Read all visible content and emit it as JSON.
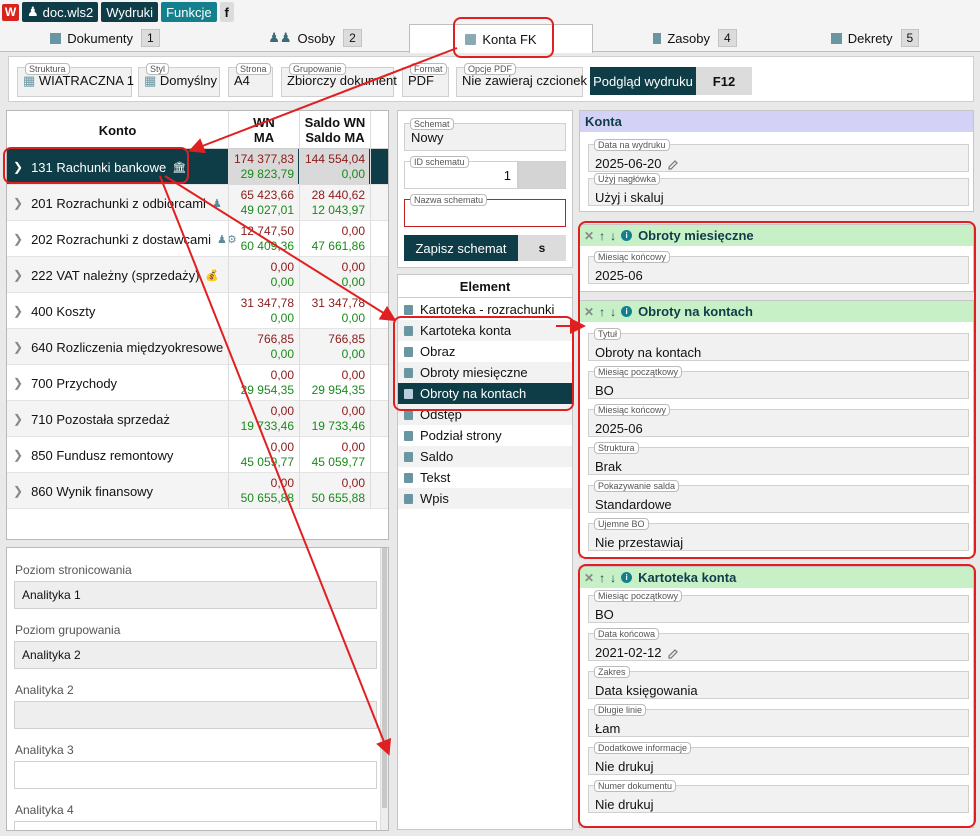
{
  "topbar": {
    "user": "doc.wls2",
    "menu1": "Wydruki",
    "menu2": "Funkcje",
    "menu3": "f"
  },
  "tabs": [
    {
      "label": "Dokumenty",
      "num": "1"
    },
    {
      "label": "Osoby",
      "num": "2"
    },
    {
      "label": "Konta FK",
      "num": ""
    },
    {
      "label": "Zasoby",
      "num": "4"
    },
    {
      "label": "Dekrety",
      "num": "5"
    }
  ],
  "options": {
    "struktura": {
      "label": "Struktura",
      "value": "WIATRACZNA 1"
    },
    "styl": {
      "label": "Styl",
      "value": "Domyślny"
    },
    "strona": {
      "label": "Strona",
      "value": "A4"
    },
    "grupowanie": {
      "label": "Grupowanie",
      "value": "Zbiorczy dokument"
    },
    "format": {
      "label": "Format",
      "value": "PDF"
    },
    "opcje": {
      "label": "Opcje PDF",
      "value": "Nie zawieraj czcionek"
    },
    "preview": "Podgląd wydruku",
    "preview_key": "F12"
  },
  "accounts": {
    "col_konto": "Konto",
    "col_wn1": "WN",
    "col_wn2": "MA",
    "col_saldo1": "Saldo WN",
    "col_saldo2": "Saldo MA",
    "rows": [
      {
        "name": "131 Rachunki bankowe",
        "icon": "bank-icon",
        "wn": "174 377,83",
        "ma": "29 823,79",
        "swn": "144 554,04",
        "sma": "0,00"
      },
      {
        "name": "201 Rozrachunki z odbiorcami",
        "icon": "person-icon",
        "wn": "65 423,66",
        "ma": "49 027,01",
        "swn": "28 440,62",
        "sma": "12 043,97"
      },
      {
        "name": "202 Rozrachunki z dostawcami",
        "icon": "person-gear-icon",
        "wn": "12 747,50",
        "ma": "60 409,36",
        "swn": "0,00",
        "sma": "47 661,86"
      },
      {
        "name": "222 VAT należny (sprzedaży)",
        "icon": "money-bag-icon",
        "wn": "0,00",
        "ma": "0,00",
        "swn": "0,00",
        "sma": "0,00"
      },
      {
        "name": "400 Koszty",
        "icon": "",
        "wn": "31 347,78",
        "ma": "0,00",
        "swn": "31 347,78",
        "sma": "0,00"
      },
      {
        "name": "640 Rozliczenia międzyokresowe",
        "icon": "",
        "wn": "766,85",
        "ma": "0,00",
        "swn": "766,85",
        "sma": "0,00"
      },
      {
        "name": "700 Przychody",
        "icon": "",
        "wn": "0,00",
        "ma": "29 954,35",
        "swn": "0,00",
        "sma": "29 954,35"
      },
      {
        "name": "710 Pozostała sprzedaż",
        "icon": "",
        "wn": "0,00",
        "ma": "19 733,46",
        "swn": "0,00",
        "sma": "19 733,46"
      },
      {
        "name": "850 Fundusz remontowy",
        "icon": "",
        "wn": "0,00",
        "ma": "45 059,77",
        "swn": "0,00",
        "sma": "45 059,77"
      },
      {
        "name": "860 Wynik finansowy",
        "icon": "",
        "wn": "0,00",
        "ma": "50 655,88",
        "swn": "0,00",
        "sma": "50 655,88"
      }
    ]
  },
  "levels": {
    "l1_label": "Poziom stronicowania",
    "l1_value": "Analityka 1",
    "l2_label": "Poziom grupowania",
    "l2_value": "Analityka 2",
    "l3_label": "Analityka 2",
    "l3_value": "",
    "l4_label": "Analityka 3",
    "l4_value": "",
    "l5_label": "Analityka 4",
    "l5_value": ""
  },
  "schema": {
    "schemat_label": "Schemat",
    "schemat_value": "Nowy",
    "id_label": "ID schematu",
    "id_value": "1",
    "name_label": "Nazwa schematu",
    "name_value": "",
    "save": "Zapisz schemat",
    "save_key": "s"
  },
  "elements": {
    "header": "Element",
    "items": [
      "Kartoteka - rozrachunki",
      "Kartoteka konta",
      "Obraz",
      "Obroty miesięczne",
      "Obroty na kontach",
      "Odstęp",
      "Podział strony",
      "Saldo",
      "Tekst",
      "Wpis"
    ]
  },
  "konta": {
    "header": "Konta",
    "data_label": "Data na wydruku",
    "data_value": "2025-06-20",
    "nagl_label": "Użyj nagłówka",
    "nagl_value": "Użyj i skaluj"
  },
  "sections": {
    "obroty_mies": {
      "title": "Obroty miesięczne",
      "f1_label": "Miesiąc końcowy",
      "f1_value": "2025-06"
    },
    "obroty_kont": {
      "title": "Obroty na kontach",
      "f1_label": "Tytuł",
      "f1_value": "Obroty na kontach",
      "f2_label": "Miesiąc początkowy",
      "f2_value": "BO",
      "f3_label": "Miesiąc końcowy",
      "f3_value": "2025-06",
      "f4_label": "Struktura",
      "f4_value": "Brak",
      "f5_label": "Pokazywanie salda",
      "f5_value": "Standardowe",
      "f6_label": "Ujemne BO",
      "f6_value": "Nie przestawiaj"
    },
    "kartoteka": {
      "title": "Kartoteka konta",
      "f1_label": "Miesiąc początkowy",
      "f1_value": "BO",
      "f2_label": "Data końcowa",
      "f2_value": "2021-02-12",
      "f3_label": "Zakres",
      "f3_value": "Data księgowania",
      "f4_label": "Długie linie",
      "f4_value": "Łam",
      "f5_label": "Dodatkowe informacje",
      "f5_value": "Nie drukuj",
      "f6_label": "Numer dokumentu",
      "f6_value": "Nie drukuj"
    }
  },
  "colors": {
    "dark": "#0e3d47",
    "teal": "#14808e",
    "annotation": "#e02020",
    "debit": "#8b1a1a",
    "credit": "#1a8a1a"
  }
}
